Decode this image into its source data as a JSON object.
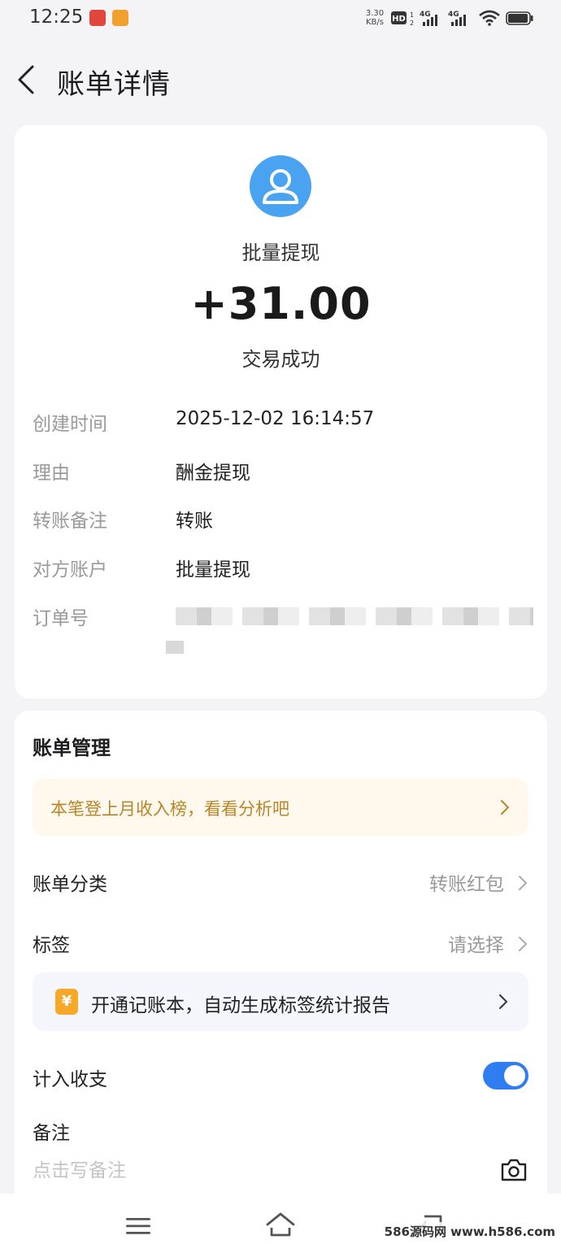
{
  "status_bar": {
    "time": "12:25",
    "net_speed_value": "3.30",
    "net_speed_unit": "KB/s",
    "hd_label": "HD",
    "signal_1": "4G",
    "signal_2": "4G"
  },
  "header": {
    "title": "账单详情",
    "back_icon": "chevron-left-icon"
  },
  "summary": {
    "avatar_icon": "user-avatar-icon",
    "payee": "批量提现",
    "amount": "+31.00",
    "status": "交易成功"
  },
  "details": [
    {
      "label": "创建时间",
      "value": "2025-12-02 16:14:57"
    },
    {
      "label": "理由",
      "value": "酬金提现"
    },
    {
      "label": "转账备注",
      "value": "转账"
    },
    {
      "label": "对方账户",
      "value": "批量提现"
    },
    {
      "label": "订单号",
      "value": ""
    }
  ],
  "management": {
    "title": "账单管理",
    "promo_text": "本笔登上月收入榜，看看分析吧",
    "category_label": "账单分类",
    "category_value": "转账红包",
    "tag_label": "标签",
    "tag_value": "请选择",
    "bookkeeping_icon_glyph": "¥",
    "bookkeeping_text": "开通记账本，自动生成标签统计报告",
    "count_label": "计入收支",
    "count_enabled": true,
    "note_label": "备注",
    "note_placeholder": "点击写备注"
  },
  "nav": {
    "menu_icon": "menu-icon",
    "home_icon": "home-icon",
    "back_icon": "back-icon"
  },
  "watermark": "586源码网 www.h586.com",
  "colors": {
    "accent_blue": "#2f7ef1",
    "avatar_blue": "#4aa3f0",
    "promo_text": "#b8852a",
    "promo_bg": "#fff8ec",
    "label_gray": "#9a9a9a",
    "yuan_orange": "#f7a829"
  }
}
